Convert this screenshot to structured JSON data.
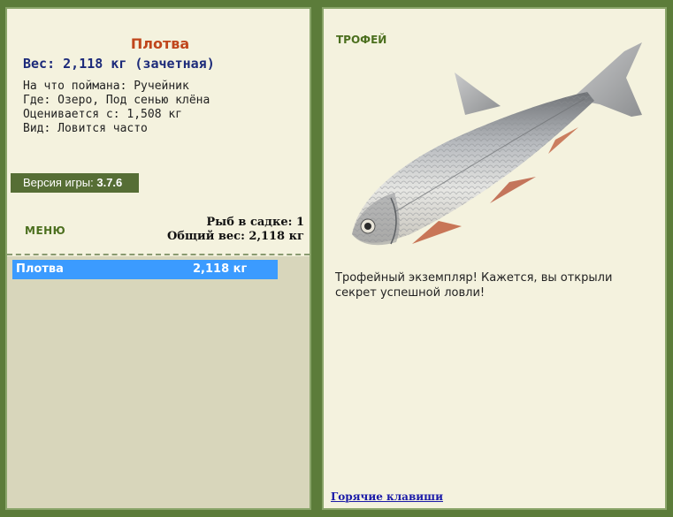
{
  "fish": {
    "name": "Плотва",
    "weight_line": "Вес: 2,118 кг (зачетная)",
    "bait_line": "На что поймана: Ручейник",
    "place_line": "Где: Озеро, Под сенью клёна",
    "min_weight_line": "Оценивается с: 1,508 кг",
    "species_line": "Вид: Ловится часто"
  },
  "version": {
    "label": "Версия игры:",
    "value": "3.7.6"
  },
  "menu": {
    "label": "МЕНЮ"
  },
  "stats": {
    "count_line": "Рыб в садке: 1",
    "total_line": "Общий вес: 2,118 кг"
  },
  "catch_list": [
    {
      "name": "Плотва",
      "weight": "2,118 кг"
    }
  ],
  "trophy": {
    "label": "ТРОФЕЙ",
    "text": "Трофейный экземпляр! Кажется, вы открыли секрет успешной ловли!"
  },
  "footer": {
    "hotkeys_label": "Горячие клавиши"
  },
  "colors": {
    "frame": "#5c7c3a",
    "panel_bg": "#f4f2de",
    "accent_green": "#4b6f1e",
    "fish_name": "#c0461c",
    "weight_text": "#1c2a7a",
    "selection": "#3b9bff"
  }
}
